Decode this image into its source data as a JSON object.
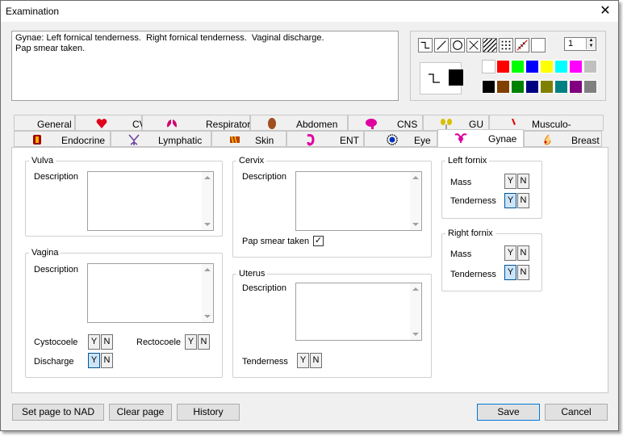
{
  "window": {
    "title": "Examination",
    "close_glyph": "✕"
  },
  "notes": {
    "text": "Gynae: Left fornical tenderness.  Right fornical tenderness.  Vaginal discharge.\nPap smear taken."
  },
  "draw_tools": {
    "tools": [
      "freehand-tool-icon",
      "line-tool-icon",
      "circle-tool-icon",
      "cross-tool-icon",
      "hatch-tool-icon",
      "dots-tool-icon",
      "erase-line-tool-icon",
      "blank-tool-icon"
    ],
    "width_value": "1",
    "current_color": "#000000",
    "palette_row1": [
      "#ffffff",
      "#ff0000",
      "#00ff00",
      "#0000ff",
      "#ffff00",
      "#00ffff",
      "#ff00ff",
      "#c0c0c0"
    ],
    "palette_row2": [
      "#000000",
      "#804000",
      "#008000",
      "#000080",
      "#808000",
      "#008080",
      "#800080",
      "#808080"
    ]
  },
  "tabs": {
    "row1": [
      {
        "label": "General",
        "icon": "",
        "icon_color": ""
      },
      {
        "label": "CVS",
        "icon": "heart-icon",
        "icon_color": "#e0001b"
      },
      {
        "label": "Respiratory",
        "icon": "lungs-icon",
        "icon_color": "#d4006e"
      },
      {
        "label": "Abdomen",
        "icon": "abdomen-icon",
        "icon_color": "#a05020"
      },
      {
        "label": "CNS",
        "icon": "brain-icon",
        "icon_color": "#e000a0"
      },
      {
        "label": "GU",
        "icon": "kidney-icon",
        "icon_color": "#d8c000"
      },
      {
        "label": "Musculo-skeletal",
        "icon": "bone-icon",
        "icon_color": "#e00000"
      }
    ],
    "row2": [
      {
        "label": "Endocrine",
        "icon": "endocrine-icon",
        "icon_color": "#a00000"
      },
      {
        "label": "Lymphatic",
        "icon": "lymphatic-icon",
        "icon_color": "#6a3c9a"
      },
      {
        "label": "Skin",
        "icon": "skin-icon",
        "icon_color": "#c04000"
      },
      {
        "label": "ENT",
        "icon": "ear-icon",
        "icon_color": "#e000a0"
      },
      {
        "label": "Eye",
        "icon": "eye-icon",
        "icon_color": "#0030c0"
      },
      {
        "label": "Gynae",
        "icon": "uterus-icon",
        "icon_color": "#e000a0"
      },
      {
        "label": "Breast",
        "icon": "breast-icon",
        "icon_color": "#e08000"
      }
    ],
    "active": "Gynae"
  },
  "gynae": {
    "vulva": {
      "legend": "Vulva",
      "description_label": "Description",
      "description": ""
    },
    "vagina": {
      "legend": "Vagina",
      "description_label": "Description",
      "description": "",
      "cystocoele_label": "Cystocoele",
      "cystocoele": "",
      "rectocoele_label": "Rectocoele",
      "rectocoele": "",
      "discharge_label": "Discharge",
      "discharge": "Y"
    },
    "cervix": {
      "legend": "Cervix",
      "description_label": "Description",
      "description": "",
      "pap_label": "Pap smear taken",
      "pap_checked": "✓"
    },
    "uterus": {
      "legend": "Uterus",
      "description_label": "Description",
      "description": "",
      "tenderness_label": "Tenderness",
      "tenderness": ""
    },
    "left_fornix": {
      "legend": "Left fornix",
      "mass_label": "Mass",
      "mass": "",
      "tenderness_label": "Tenderness",
      "tenderness": "Y"
    },
    "right_fornix": {
      "legend": "Right fornix",
      "mass_label": "Mass",
      "mass": "",
      "tenderness_label": "Tenderness",
      "tenderness": "Y"
    },
    "y_label": "Y",
    "n_label": "N"
  },
  "buttons": {
    "nad": "Set page to NAD",
    "clear": "Clear page",
    "history": "History",
    "save": "Save",
    "cancel": "Cancel"
  }
}
